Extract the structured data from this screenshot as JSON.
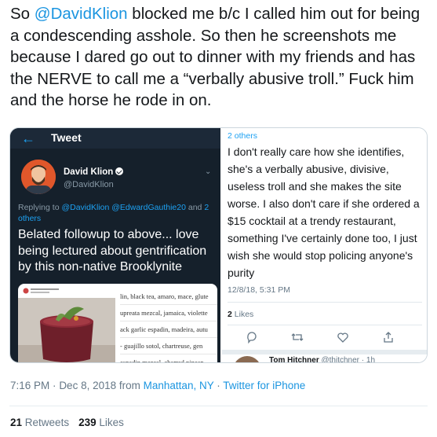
{
  "tweet": {
    "text_pre": "So ",
    "mention": "@DavidKlion",
    "text_post": " blocked me b/c I called him out for being a condescending asshole. So then he screenshots me because I dared go out to dinner with my friends and has the NERVE to call me a “verbally abusive troll.” Fuck him and the horse he rode in on.",
    "time": "7:16 PM",
    "sep": "·",
    "date": "Dec 8, 2018",
    "from": "from",
    "location": "Manhattan, NY",
    "client": "Twitter for iPhone",
    "retweets_count": "21",
    "retweets_label": "Retweets",
    "likes_count": "239",
    "likes_label": "Likes"
  },
  "left_screenshot": {
    "back_icon": "arrow-left",
    "header_title": "Tweet",
    "author_name": "David Klion",
    "author_handle": "@DavidKlion",
    "replying_prefix": "Replying to ",
    "replying_to_1": "@DavidKlion",
    "replying_to_2": "@EdwardGauthie20",
    "replying_and": " and",
    "replying_others": "2 others",
    "text": "Belated followup to above... love being lectured about gentrification by this non-native Brooklynite",
    "menu_lines": [
      "lin, black tea, amaro, mace, glute",
      "upreata mezcal, jamaica, violette",
      "ack garlic espadin, madeira, autu",
      "- guajillo sotol, chartreuse, gen",
      "espadin mezcal, charred pineap"
    ]
  },
  "right_screenshot": {
    "others": "2 others",
    "text": "I don't really care how she identifies, she's a verbally abusive, divisive, useless troll and she makes the site worse. I also don't care if she ordered a $15 cocktail at a trendy restaurant, something I've certainly done too, I just wish she would stop policing anyone's purity",
    "date": "12/8/18, 5:31 PM",
    "likes_count": "2",
    "likes_label": "Likes",
    "reply_author": "Tom Hitchner",
    "reply_handle": "@thitchner · 1h"
  },
  "colors": {
    "link": "#1b95e0",
    "dark_bg": "#15202b",
    "twitter_blue": "#1da1f2"
  }
}
